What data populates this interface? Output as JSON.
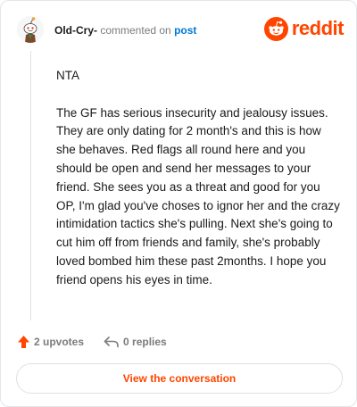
{
  "header": {
    "username": "Old-Cry-",
    "action_text": "commented on",
    "target_link": "post",
    "brand_name": "reddit",
    "brand_color": "#ff4500",
    "avatar_icon": "snoo-avatar-icon"
  },
  "comment": {
    "paragraphs": [
      "NTA",
      "The GF has serious insecurity and jealousy issues. They are only dating for 2 month's and this is how she behaves. Red flags all round here and you should be open and send her messages to your friend. She sees you as a threat and good for you OP, I'm glad you've choses to ignor her and the crazy intimidation tactics she's pulling. Next she's going to cut him off from friends and family, she's probably loved bombed him these past 2months. I hope you friend opens his eyes in time."
    ]
  },
  "actions": {
    "upvotes_label": "2 upvotes",
    "replies_label": "0 replies",
    "upvote_icon": "upvote-arrow-icon",
    "reply_icon": "reply-arrow-icon"
  },
  "cta": {
    "label": "View the conversation"
  }
}
